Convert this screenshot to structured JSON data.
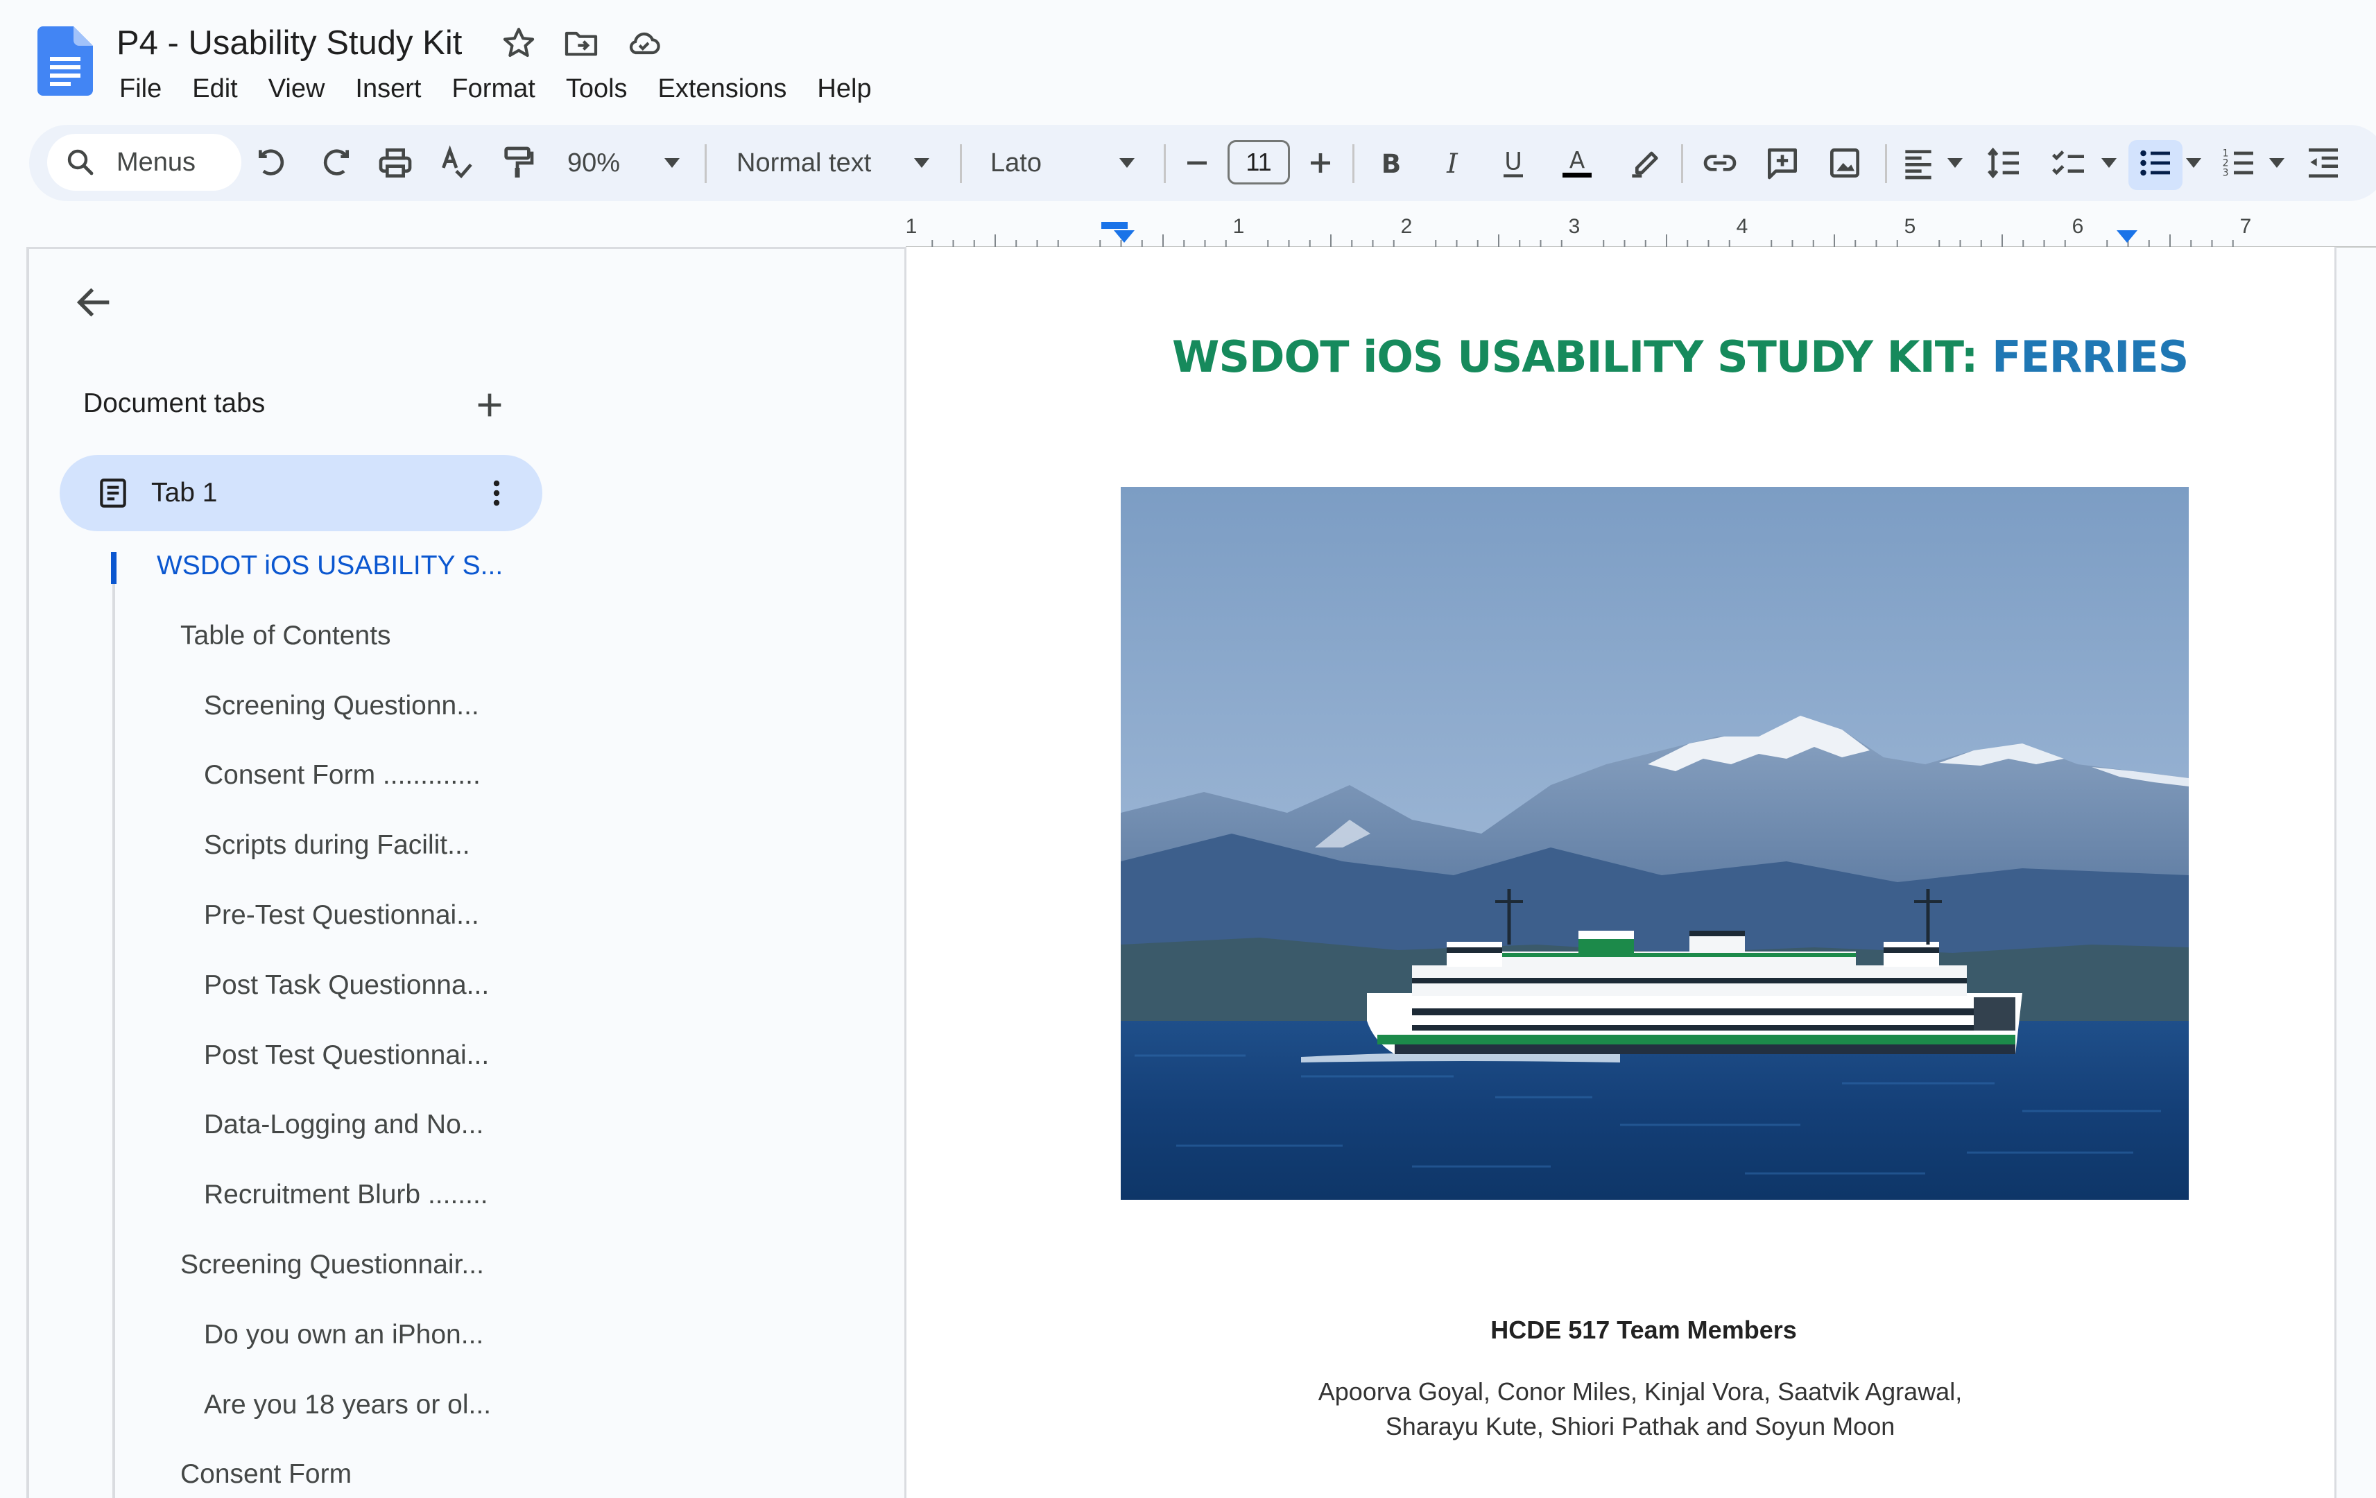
{
  "doc": {
    "title": "P4 - Usability Study Kit"
  },
  "menubar": [
    "File",
    "Edit",
    "View",
    "Insert",
    "Format",
    "Tools",
    "Extensions",
    "Help"
  ],
  "toolbar": {
    "search_label": "Menus",
    "zoom": "90%",
    "style": "Normal text",
    "font": "Lato",
    "font_size": "11",
    "icons": [
      "undo-icon",
      "redo-icon",
      "print-icon",
      "spellcheck-icon",
      "paint-format-icon",
      "bold-icon",
      "italic-icon",
      "underline-icon",
      "text-color-icon",
      "highlight-icon",
      "link-icon",
      "comment-icon",
      "image-icon",
      "align-icon",
      "line-spacing-icon",
      "checklist-icon",
      "bulleted-list-icon",
      "numbered-list-icon",
      "decrease-indent-icon"
    ]
  },
  "ruler": {
    "labels": [
      "1",
      "1",
      "2",
      "3",
      "4",
      "5",
      "6",
      "7"
    ]
  },
  "sidebar": {
    "section_label": "Document tabs",
    "tab": {
      "label": "Tab 1"
    },
    "outline": [
      {
        "text": "WSDOT iOS USABILITY S...",
        "level": 0,
        "active": true
      },
      {
        "text": "Table of Contents",
        "level": 1
      },
      {
        "text": "Screening Questionn...",
        "level": 2
      },
      {
        "text": "Consent Form .............",
        "level": 2
      },
      {
        "text": "Scripts during Facilit...",
        "level": 2
      },
      {
        "text": "Pre-Test Questionnai...",
        "level": 2
      },
      {
        "text": "Post Task Questionna...",
        "level": 2
      },
      {
        "text": "Post Test Questionnai...",
        "level": 2
      },
      {
        "text": "Data-Logging and No...",
        "level": 2
      },
      {
        "text": "Recruitment Blurb ........",
        "level": 2
      },
      {
        "text": "Screening Questionnair...",
        "level": 1
      },
      {
        "text": "Do you own an iPhon...",
        "level": 2
      },
      {
        "text": "Are you 18 years or ol...",
        "level": 2
      },
      {
        "text": "Consent Form",
        "level": 1
      }
    ]
  },
  "document": {
    "heading_part1": "WSDOT iOS USABILITY STUDY KIT: ",
    "heading_part2": "FERRIES",
    "team_heading": "HCDE 517 Team Members",
    "team_line1": "Apoorva Goyal, Conor Miles, Kinjal Vora, Saatvik Agrawal,",
    "team_line2": "Sharayu Kute, Shiori Pathak and Soyun Moon"
  },
  "colors": {
    "heading_green": "#168a5c",
    "heading_blue": "#1f77b4",
    "accent": "#0b57d0",
    "selected_bg": "#d3e3fd"
  }
}
